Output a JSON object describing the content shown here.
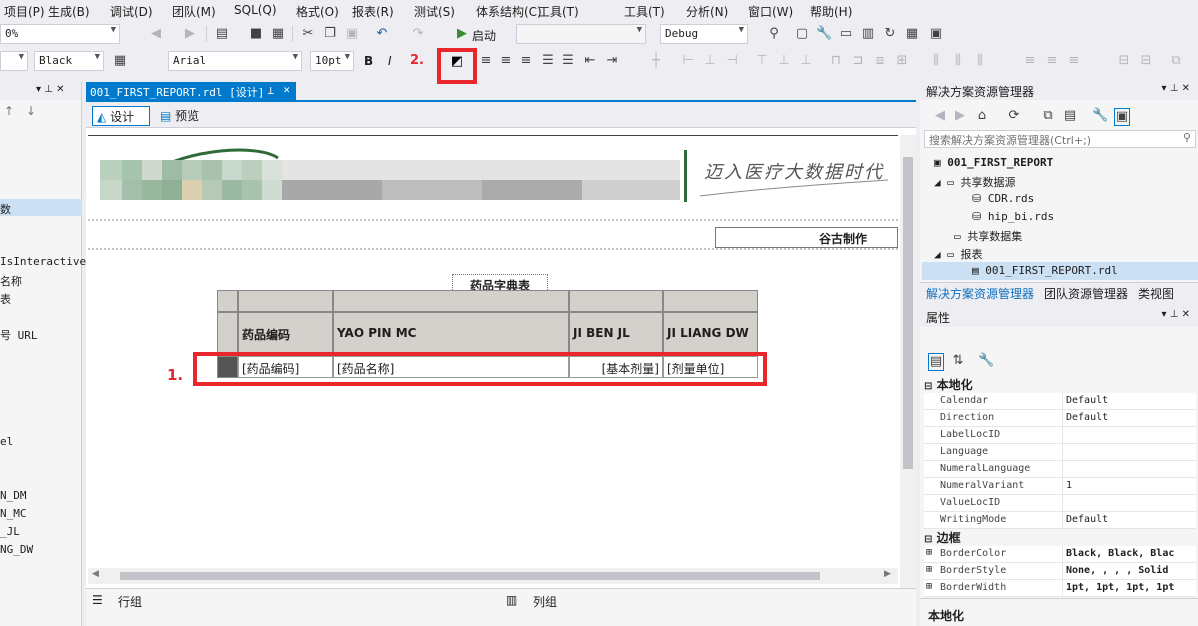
{
  "menu": [
    "项目(P)",
    "生成(B)",
    "调试(D)",
    "团队(M)",
    "SQL(Q)",
    "格式(O)",
    "报表(R)",
    "测试(S)",
    "体系结构(C)",
    "工具(T)",
    "分析(N)",
    "窗口(W)",
    "帮助(H)"
  ],
  "toolbar1": {
    "zoom_value": "0%",
    "start_label": "启动",
    "config_value": "Debug"
  },
  "toolbar2": {
    "color_value": "Black",
    "font_value": "Arial",
    "size_value": "10pt",
    "bold": "B",
    "italic": "I",
    "underline": "U",
    "step_marker": "2."
  },
  "left_panel": {
    "items": [
      "数",
      "IsInteractive",
      "名称",
      "表",
      "号 URL",
      "el",
      "N_DM",
      "N_MC",
      "_JL",
      "NG_DW"
    ]
  },
  "document": {
    "tab_title": "001_FIRST_REPORT.rdl [设计]",
    "tab_design": "设计",
    "tab_preview": "预览",
    "banner_text": "迈入医疗大数据时代",
    "author_text": "谷古制作",
    "table_title": "药品字典表",
    "headers": [
      "药品编码",
      "YAO PIN MC",
      "JI BEN JL",
      "JI LIANG DW"
    ],
    "data_row": [
      "[药品编码]",
      "[药品名称]",
      "[基本剂量]",
      "[剂量单位]"
    ],
    "step_marker": "1.",
    "row_groups_label": "行组",
    "col_groups_label": "列组"
  },
  "solution_explorer": {
    "title": "解决方案资源管理器",
    "search_placeholder": "搜索解决方案资源管理器(Ctrl+;)",
    "project": "001_FIRST_REPORT",
    "shared_ds_folder": "共享数据源",
    "ds1": "CDR.rds",
    "ds2": "hip_bi.rds",
    "shared_dataset_folder": "共享数据集",
    "reports_folder": "报表",
    "report_file": "001_FIRST_REPORT.rdl",
    "bottom_tabs": [
      "解决方案资源管理器",
      "团队资源管理器",
      "类视图"
    ]
  },
  "properties": {
    "title": "属性",
    "cat_localization": "本地化",
    "cat_border": "边框",
    "rows_localization": [
      {
        "k": "Calendar",
        "v": "Default"
      },
      {
        "k": "Direction",
        "v": "Default"
      },
      {
        "k": "LabelLocID",
        "v": ""
      },
      {
        "k": "Language",
        "v": ""
      },
      {
        "k": "NumeralLanguage",
        "v": ""
      },
      {
        "k": "NumeralVariant",
        "v": "1"
      },
      {
        "k": "ValueLocID",
        "v": ""
      },
      {
        "k": "WritingMode",
        "v": "Default"
      }
    ],
    "rows_border": [
      {
        "k": "BorderColor",
        "v": "Black, Black, Blac"
      },
      {
        "k": "BorderStyle",
        "v": "None, , , , Solid"
      },
      {
        "k": "BorderWidth",
        "v": "1pt, 1pt, 1pt, 1pt"
      }
    ],
    "description_title": "本地化"
  },
  "colors": {
    "accent": "#007acc",
    "highlight": "#e8262c"
  }
}
